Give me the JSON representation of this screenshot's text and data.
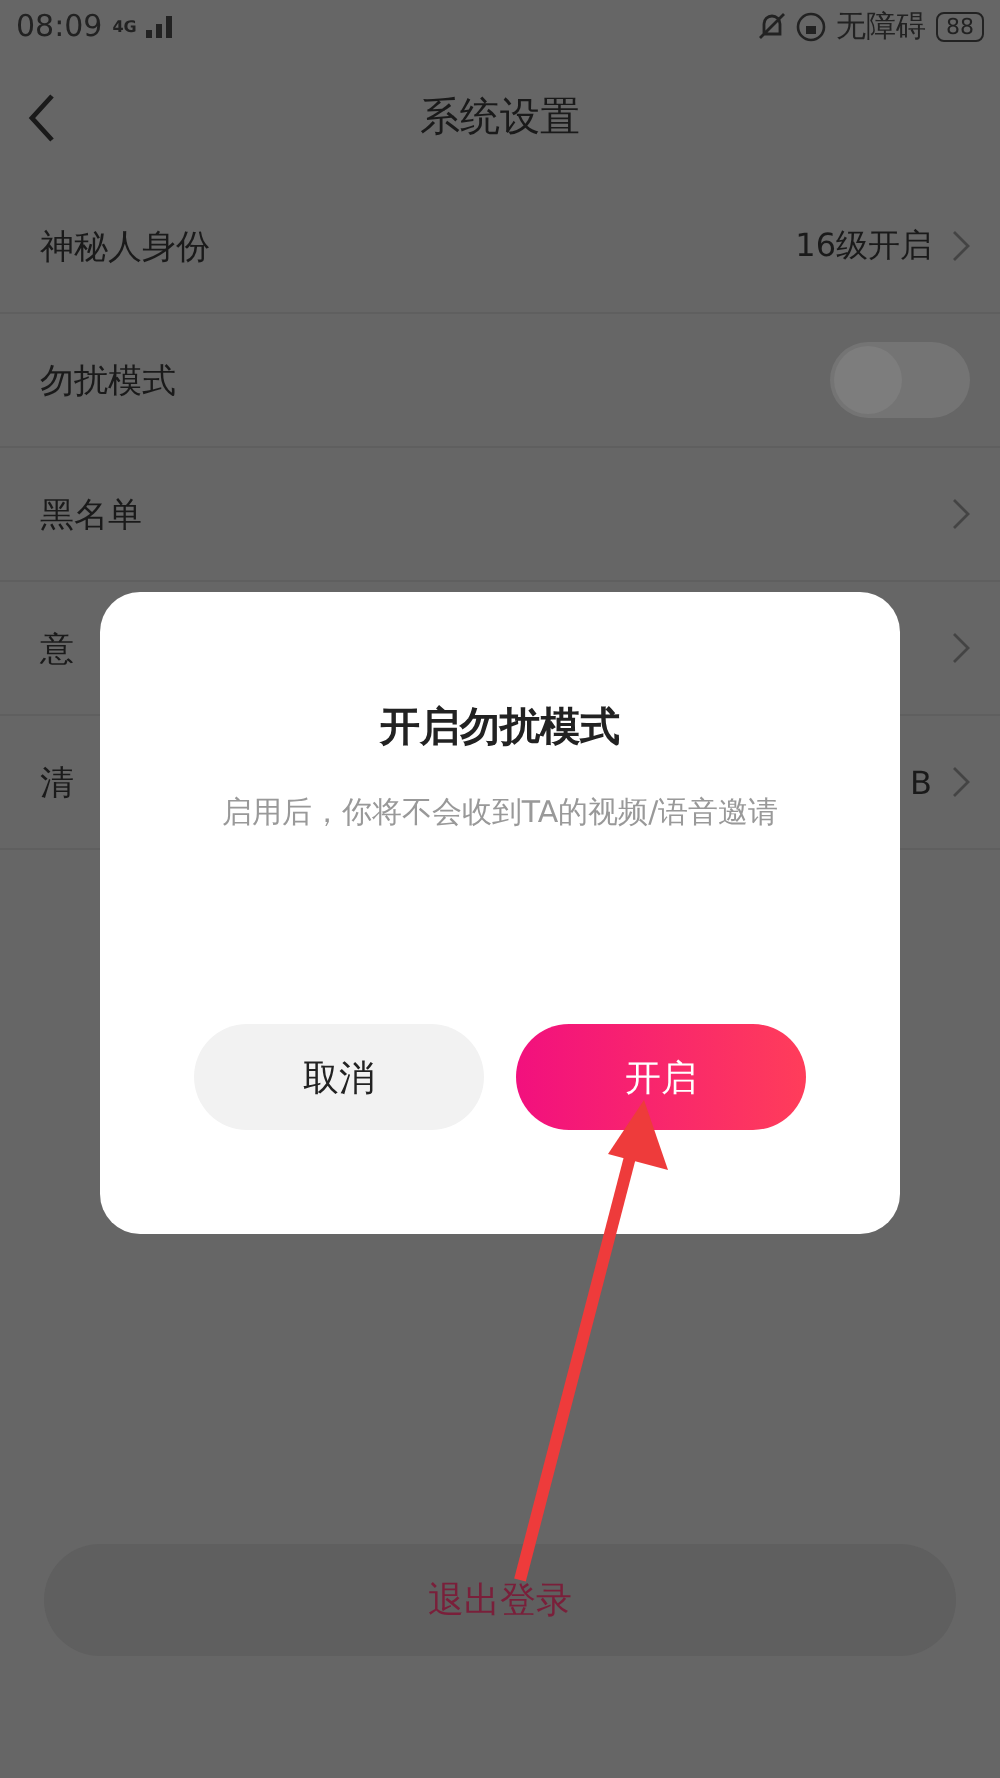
{
  "status_bar": {
    "time": "08:09",
    "network": "4G",
    "accessibility": "无障碍",
    "battery": "88"
  },
  "header": {
    "title": "系统设置"
  },
  "settings": [
    {
      "kind": "link",
      "label": "神秘人身份",
      "value": "16级开启"
    },
    {
      "kind": "toggle",
      "label": "勿扰模式",
      "on": false
    },
    {
      "kind": "link",
      "label": "黑名单"
    },
    {
      "kind": "link",
      "label": "意"
    },
    {
      "kind": "link",
      "label": "清",
      "value": "B"
    }
  ],
  "logout_button": "退出登录",
  "dialog": {
    "title": "开启勿扰模式",
    "message": "启用后，你将不会收到TA的视频/语音邀请",
    "buttons": [
      {
        "kind": "cancel",
        "label": "取消"
      },
      {
        "kind": "confirm",
        "label": "开启"
      }
    ]
  }
}
